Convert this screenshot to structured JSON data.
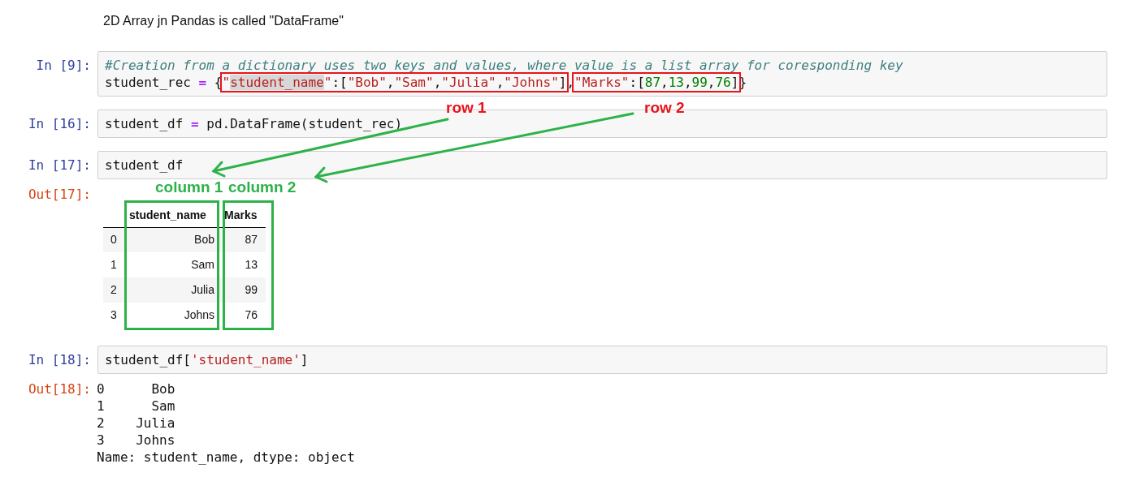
{
  "intro": "2D Array jn Pandas is called \"DataFrame\"",
  "cells": [
    {
      "prompt": "In [9]:",
      "lines": [
        [
          {
            "kind": "plain",
            "tokens": [
              {
                "kind": "comment",
                "text": "#Creation from a dictionary uses two keys and values, where value is a list array for coresponding key"
              }
            ]
          }
        ],
        [
          {
            "kind": "plain",
            "tokens": [
              {
                "kind": "name",
                "text": "student_rec "
              },
              {
                "kind": "op",
                "text": "="
              },
              {
                "kind": "punct",
                "text": " {"
              }
            ]
          },
          {
            "kind": "boxed",
            "tokens": [
              {
                "kind": "str",
                "text": "\""
              },
              {
                "kind": "str_selected",
                "text": "student_name"
              },
              {
                "kind": "str",
                "text": "\""
              },
              {
                "kind": "punct",
                "text": ":["
              },
              {
                "kind": "str",
                "text": "\"Bob\""
              },
              {
                "kind": "punct",
                "text": ","
              },
              {
                "kind": "str",
                "text": "\"Sam\""
              },
              {
                "kind": "punct",
                "text": ","
              },
              {
                "kind": "str",
                "text": "\"Julia\""
              },
              {
                "kind": "punct",
                "text": ","
              },
              {
                "kind": "str",
                "text": "\"Johns\""
              },
              {
                "kind": "punct",
                "text": "]"
              }
            ]
          },
          {
            "kind": "plain",
            "tokens": [
              {
                "kind": "punct",
                "text": ","
              }
            ]
          },
          {
            "kind": "boxed",
            "tokens": [
              {
                "kind": "str",
                "text": "\"Marks\""
              },
              {
                "kind": "punct",
                "text": ":["
              },
              {
                "kind": "num",
                "text": "87"
              },
              {
                "kind": "punct",
                "text": ","
              },
              {
                "kind": "num",
                "text": "13"
              },
              {
                "kind": "punct",
                "text": ","
              },
              {
                "kind": "num",
                "text": "99"
              },
              {
                "kind": "punct",
                "text": ","
              },
              {
                "kind": "num",
                "text": "76"
              },
              {
                "kind": "punct",
                "text": "]"
              }
            ]
          },
          {
            "kind": "plain",
            "tokens": [
              {
                "kind": "punct",
                "text": "}"
              }
            ]
          }
        ]
      ]
    },
    {
      "prompt": "In [16]:",
      "lines": [
        [
          {
            "kind": "plain",
            "tokens": [
              {
                "kind": "name",
                "text": "student_df "
              },
              {
                "kind": "op",
                "text": "="
              },
              {
                "kind": "name",
                "text": " pd.DataFrame(student_rec)"
              }
            ]
          }
        ]
      ]
    },
    {
      "prompt": "In [17]:",
      "lines": [
        [
          {
            "kind": "plain",
            "tokens": [
              {
                "kind": "name",
                "text": "student_df"
              }
            ]
          }
        ]
      ],
      "output": {
        "prompt": "Out[17]:",
        "kind": "table",
        "columns": [
          {
            "label": "student_name",
            "boxed": true
          },
          {
            "label": "Marks",
            "boxed": true
          }
        ],
        "rows": [
          {
            "index": "0",
            "cells": [
              "Bob",
              "87"
            ]
          },
          {
            "index": "1",
            "cells": [
              "Sam",
              "13"
            ]
          },
          {
            "index": "2",
            "cells": [
              "Julia",
              "99"
            ]
          },
          {
            "index": "3",
            "cells": [
              "Johns",
              "76"
            ]
          }
        ]
      }
    },
    {
      "prompt": "In [18]:",
      "lines": [
        [
          {
            "kind": "plain",
            "tokens": [
              {
                "kind": "name",
                "text": "student_df["
              },
              {
                "kind": "str",
                "text": "'student_name'"
              },
              {
                "kind": "name",
                "text": "]"
              }
            ]
          }
        ]
      ],
      "output": {
        "prompt": "Out[18]:",
        "kind": "text",
        "lines": [
          "0      Bob",
          "1      Sam",
          "2    Julia",
          "3    Johns",
          "Name: student_name, dtype: object"
        ]
      }
    }
  ],
  "annotations": [
    {
      "text": "row 1",
      "color": "#e8141c"
    },
    {
      "text": "row 2",
      "color": "#e8141c"
    },
    {
      "text": "column 1",
      "color": "#2db24a"
    },
    {
      "text": "column 2",
      "color": "#2db24a"
    }
  ]
}
